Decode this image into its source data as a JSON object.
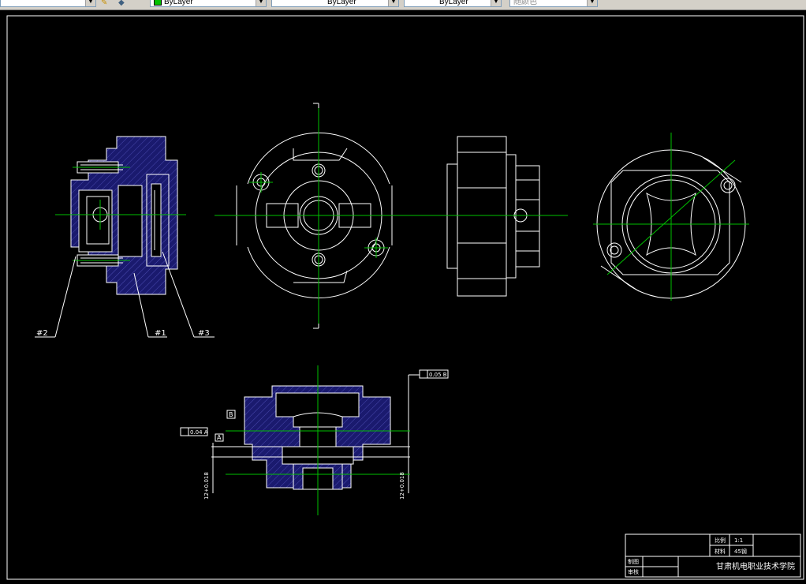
{
  "toolbar": {
    "combo1_value": "",
    "layer_value": "ByLayer",
    "linetype_value": "ByLayer",
    "lineweight_value": "ByLayer",
    "plotstyle_value": "随颜色"
  },
  "callouts": {
    "part2": "#2",
    "part1": "#1",
    "part3": "#3"
  },
  "tolerances": {
    "datum_a": "A",
    "datum_b": "B",
    "flatness_frame": "0.04 A",
    "perp_frame": "0.05 B",
    "dim_left": "12+0.018",
    "dim_right": "12+0.018"
  },
  "title_block": {
    "scale_label": "比例",
    "scale_value": "1:1",
    "material_label": "材料",
    "material_value": "45钢",
    "drawn_label": "制图",
    "checked_label": "审核",
    "institution": "甘肃机电职业技术学院"
  },
  "colors": {
    "centerline": "#00c000",
    "hatch": "#1a1a6e",
    "outline": "#ffffff",
    "background": "#000000"
  }
}
